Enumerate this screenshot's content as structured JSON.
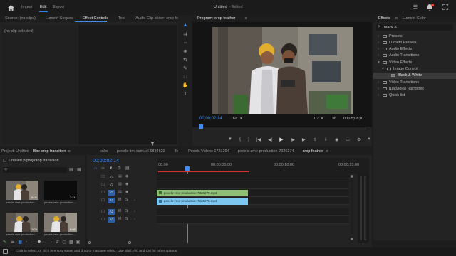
{
  "header": {
    "home_icon": "home-icon",
    "menu": [
      "Import",
      "Edit",
      "Export"
    ],
    "title": "Untitled",
    "subtitle": "- Edited"
  },
  "source_panel": {
    "tabs": [
      "Source: (no clips)",
      "Lumetri Scopes",
      "Effect Controls",
      "Text",
      "Audio Clip Mixer: crop fe"
    ],
    "no_clip": "(no clip selected)"
  },
  "program": {
    "title": "Program: crop feather",
    "timecode": "00;00;02;14",
    "fit": "Fit",
    "ratio": "1/2",
    "duration": "00;05;08;01"
  },
  "effects": {
    "tabs": [
      "Effects",
      "Lumetri Color"
    ],
    "search": "black &",
    "tree": [
      {
        "label": "Presets",
        "level": 0,
        "type": "folder"
      },
      {
        "label": "Lumetri Presets",
        "level": 0,
        "type": "folder"
      },
      {
        "label": "Audio Effects",
        "level": 0,
        "type": "folder"
      },
      {
        "label": "Audio Transitions",
        "level": 0,
        "type": "folder"
      },
      {
        "label": "Video Effects",
        "level": 0,
        "type": "folder"
      },
      {
        "label": "Image Control",
        "level": 1,
        "type": "folder"
      },
      {
        "label": "Black & White",
        "level": 2,
        "type": "effect",
        "selected": true
      },
      {
        "label": "Video Transitions",
        "level": 0,
        "type": "folder"
      },
      {
        "label": "Шаблоны настроек",
        "level": 0,
        "type": "folder"
      },
      {
        "label": "Quick list",
        "level": 0,
        "type": "folder"
      }
    ]
  },
  "project": {
    "tabs": [
      "Project: Untitled",
      "Bin: crop transition"
    ],
    "path": "Untitled.prproj\\crop transition",
    "thumbs": [
      {
        "name": "pexels-zme-production-...",
        "duration": "5:08"
      },
      {
        "name": "pexels-zme-production-...",
        "duration": "7:11"
      },
      {
        "name": "pexels-zme-production-...",
        "duration": "13:08"
      },
      {
        "name": "pexels-zme-production-...",
        "duration": "5:08"
      }
    ]
  },
  "timeline": {
    "tabs": [
      "color",
      "pexels-tim-samuel-5834623",
      "fx",
      "Pexels Videos 1721294",
      "pexels-zme-production-7326274",
      "crop feather"
    ],
    "timecode": "00:00:02:14",
    "ruler": [
      "00:00",
      "00:00:05:00",
      "00:00:10:00",
      "00:00:15:00"
    ],
    "video_tracks": [
      "V3",
      "V2",
      "V1"
    ],
    "audio_tracks": [
      "A1",
      "A2",
      "A3"
    ],
    "track_target": "V1",
    "clips": [
      {
        "label": "pexels-zme-production-7326270.mp4",
        "track": "V1"
      },
      {
        "label": "pexels-zme-production-7326270.mp4",
        "track": "A1"
      }
    ]
  },
  "status": {
    "text": "Click to select, or click in empty space and drag to marquee select. Use Shift, Alt, and Ctrl for other options."
  },
  "colors": {
    "accent": "#3f8cf0",
    "video_clip": "#8fbf75",
    "audio_clip": "#7cc6ef",
    "playhead_range": "#d9332c",
    "selected": "#3a3a3a"
  }
}
